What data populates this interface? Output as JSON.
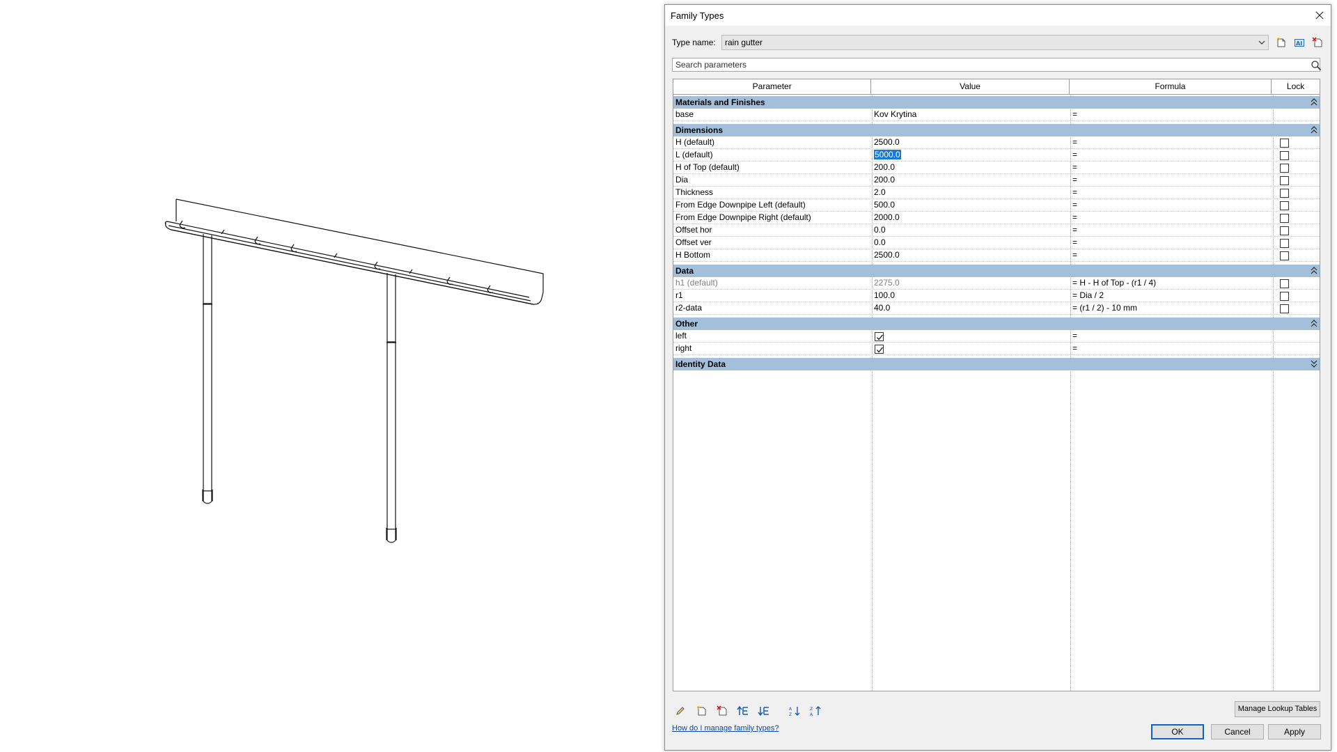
{
  "dialog": {
    "title": "Family Types",
    "type_name_label": "Type name:",
    "type_name_value": "rain gutter",
    "search_placeholder": "Search parameters"
  },
  "table": {
    "columns": [
      "Parameter",
      "Value",
      "Formula",
      "Lock"
    ],
    "groups": [
      {
        "name": "Materials and Finishes",
        "collapsed": false,
        "rows": [
          {
            "param": "base",
            "value": "Kov Krytina",
            "formula": "=",
            "lock": null
          }
        ]
      },
      {
        "name": "Dimensions",
        "collapsed": false,
        "rows": [
          {
            "param": "H (default)",
            "value": "2500.0",
            "formula": "=",
            "lock": false
          },
          {
            "param": "L (default)",
            "value": "5000.0",
            "formula": "=",
            "lock": false,
            "selected": true
          },
          {
            "param": "H of Top (default)",
            "value": "200.0",
            "formula": "=",
            "lock": false
          },
          {
            "param": "Dia",
            "value": "200.0",
            "formula": "=",
            "lock": false
          },
          {
            "param": "Thickness",
            "value": "2.0",
            "formula": "=",
            "lock": false
          },
          {
            "param": "From Edge Downpipe Left (default)",
            "value": "500.0",
            "formula": "=",
            "lock": false
          },
          {
            "param": "From Edge Downpipe Right (default)",
            "value": "2000.0",
            "formula": "=",
            "lock": false
          },
          {
            "param": "Offset hor",
            "value": "0.0",
            "formula": "=",
            "lock": false
          },
          {
            "param": "Offset ver",
            "value": "0.0",
            "formula": "=",
            "lock": false
          },
          {
            "param": "H Bottom",
            "value": "2500.0",
            "formula": "=",
            "lock": false
          }
        ]
      },
      {
        "name": "Data",
        "collapsed": false,
        "rows": [
          {
            "param": "h1 (default)",
            "value": "2275.0",
            "formula": "= H - H of Top - (r1 / 4)",
            "lock": false,
            "muted": true
          },
          {
            "param": "r1",
            "value": "100.0",
            "formula": "= Dia / 2",
            "lock": false
          },
          {
            "param": "r2-data",
            "value": "40.0",
            "formula": "= (r1 / 2) - 10 mm",
            "lock": false
          }
        ]
      },
      {
        "name": "Other",
        "collapsed": false,
        "rows": [
          {
            "param": "left",
            "value_check": true,
            "formula": "=",
            "lock": null
          },
          {
            "param": "right",
            "value_check": true,
            "formula": "=",
            "lock": null
          }
        ]
      },
      {
        "name": "Identity Data",
        "collapsed": true,
        "rows": []
      }
    ]
  },
  "buttons": {
    "manage_lookup": "Manage Lookup Tables",
    "help": "How do I manage family types?",
    "ok": "OK",
    "cancel": "Cancel",
    "apply": "Apply"
  },
  "colors": {
    "group_header": "#a4bfd9",
    "selection": "#1979d2",
    "link": "#0b49b8"
  }
}
